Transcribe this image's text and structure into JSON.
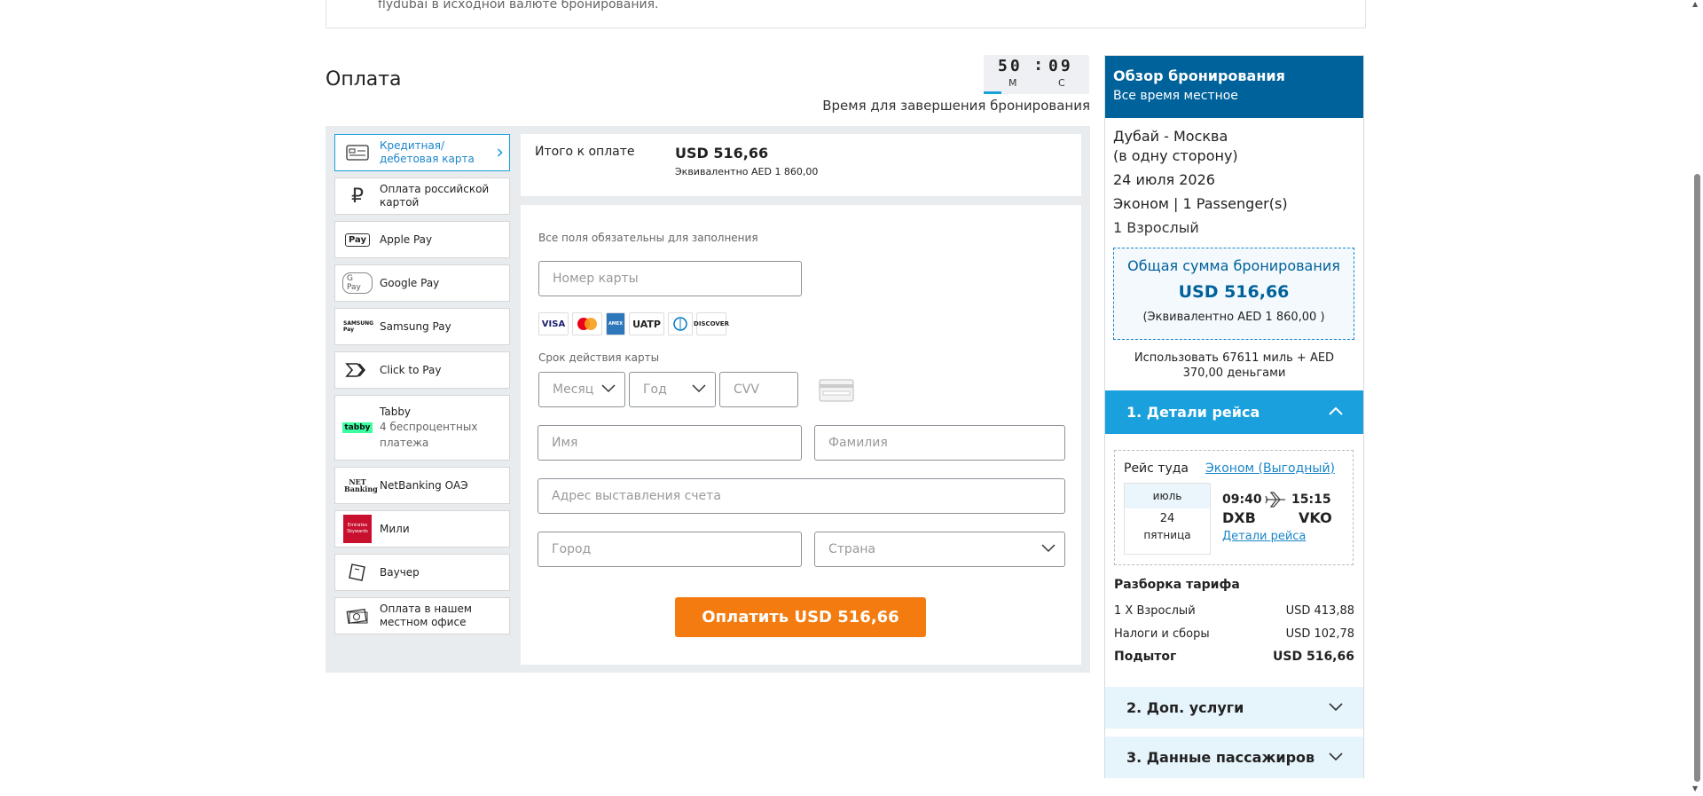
{
  "top_notice": "flydubai в исходной валюте бронирования.",
  "payment": {
    "title": "Оплата",
    "timer": {
      "minutes": "50",
      "seconds": "09",
      "min_label": "М",
      "sec_label": "С",
      "caption": "Время для завершения бронирования"
    },
    "methods": [
      {
        "label": "Кредитная/дебетовая карта",
        "icon": "credit-card-icon"
      },
      {
        "label": "Оплата российской картой",
        "icon": "ruble-icon"
      },
      {
        "label": "Apple Pay",
        "icon": "apple-pay-icon",
        "icon_text": "Pay"
      },
      {
        "label": "Google Pay",
        "icon": "google-pay-icon",
        "icon_text": "G Pay"
      },
      {
        "label": "Samsung Pay",
        "icon": "samsung-pay-icon",
        "icon_text": "SAMSUNG Pay"
      },
      {
        "label": "Click to Pay",
        "icon": "click-to-pay-icon"
      },
      {
        "label": "Tabby",
        "sub": "4 беспроцентных платежа",
        "icon": "tabby-icon",
        "icon_text": "tabby"
      },
      {
        "label": "NetBanking ОАЭ",
        "icon": "netbanking-icon",
        "icon_text": "NET Banking"
      },
      {
        "label": "Мили",
        "icon": "emirates-skywards-icon",
        "icon_text": "Emirates Skywards"
      },
      {
        "label": "Ваучер",
        "icon": "voucher-icon"
      },
      {
        "label": "Оплата в нашем местном офисе",
        "icon": "cash-icon"
      }
    ],
    "total": {
      "label": "Итого к оплате",
      "value": "USD 516,66",
      "equiv": "Эквивалентно AED 1 860,00"
    },
    "form": {
      "required_note": "Все поля обязательны для заполнения",
      "card_number_placeholder": "Номер карты",
      "card_logos": [
        "VISA",
        "mastercard",
        "AMEX",
        "UATP",
        "Diners Club",
        "DISCOVER"
      ],
      "expiry_label": "Срок действия карты",
      "month_placeholder": "Месяц",
      "year_placeholder": "Год",
      "cvv_placeholder": "CVV",
      "first_name_placeholder": "Имя",
      "last_name_placeholder": "Фамилия",
      "address_placeholder": "Адрес выставления счета",
      "city_placeholder": "Город",
      "country_placeholder": "Страна",
      "pay_button": "Оплатить USD 516,66"
    }
  },
  "summary": {
    "header_title": "Обзор бронирования",
    "header_sub": "Все время местное",
    "route": "Дубай - Москва",
    "trip_type": "(в одну сторону)",
    "date": "24 июля 2026",
    "cabin": "Эконом | 1 Passenger(s)",
    "pax": "1 Взрослый",
    "total_label": "Общая сумма бронирования",
    "total_value": "USD 516,66",
    "total_equiv": "(Эквивалентно AED 1 860,00 )",
    "miles_text": "Использовать 67611 миль + AED 370,00 деньгами",
    "section1": "1. Детали рейса",
    "segment": {
      "direction": "Рейс туда",
      "fare_class": "Эконом (Выгодный)",
      "month": "июль",
      "day": "24",
      "weekday": "пятница",
      "dep_time": "09:40",
      "arr_time": "15:15",
      "dep_code": "DXB",
      "arr_code": "VKO",
      "details_link": "Детали рейса"
    },
    "fare_title": "Разборка тарифа",
    "fare_rows": [
      {
        "label": "1 X Взрослый",
        "value": "USD 413,88"
      },
      {
        "label": "Налоги и сборы",
        "value": "USD 102,78"
      },
      {
        "label": "Подытог",
        "value": "USD 516,66"
      }
    ],
    "section2": "2. Доп. услуги",
    "section3": "3. Данные пассажиров"
  },
  "colors": {
    "brand_dark": "#00629b",
    "brand_light": "#1aa0dd",
    "pay_button": "#f47b0f"
  }
}
